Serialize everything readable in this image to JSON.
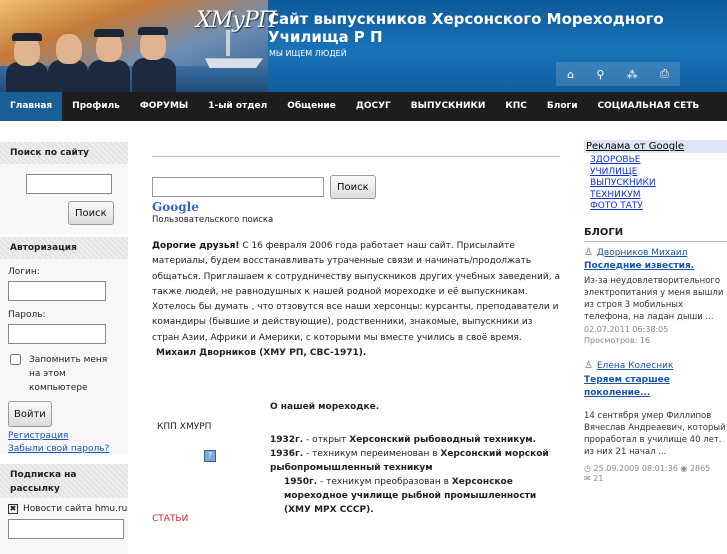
{
  "header": {
    "logo": "ХМуРП",
    "title": "Сайт выпускников Херсонского Мореходного Училища Р П",
    "slogan": "МЫ ИЩЕМ ЛЮДЕЙ",
    "tools": [
      {
        "icon": "home-icon",
        "glyph": "⌂"
      },
      {
        "icon": "search-icon",
        "glyph": "⚲"
      },
      {
        "icon": "sitemap-icon",
        "glyph": "⁂"
      },
      {
        "icon": "print-icon",
        "glyph": "⎙"
      }
    ]
  },
  "nav": {
    "items": [
      "Главная",
      "Профиль",
      "ФОРУМЫ",
      "1-ый отдел",
      "Общение",
      "ДОСУГ",
      "ВЫПУСКНИКИ",
      "КПС",
      "Блоги",
      "СОЦИАЛЬНАЯ СЕТЬ"
    ]
  },
  "sidebar": {
    "search": {
      "title": "Поиск по сайту",
      "button": "Поиск"
    },
    "auth": {
      "title": "Авторизация",
      "login_label": "Логин:",
      "password_label": "Пароль:",
      "remember_label": "Запомнить меня на этом компьютере",
      "submit": "Войти",
      "register": "Регистрация",
      "forgot": "Забыли свой пароль?"
    },
    "subscribe": {
      "title": "Подписка на рассылку",
      "option": "Новости сайта hmu.ru"
    }
  },
  "main": {
    "search_button": "Поиск",
    "google_logo": "Google",
    "google_caption": "Пользовательского поиска",
    "intro_lead": "Дорогие друзья!",
    "intro_text": " С 16 февраля 2006 года работает наш сайт. Присылайте материалы, будем восстанавливать утраченные связи и начинать/продолжать общаться. Приглашаем к сотрудничеству выпускников других учебных заведений, а также людей, не равнодушных к нашей родной мореходке и её выпускникам. Хотелось бы думать , что отзовутся все наши херсонцы: курсанты, преподаватели и командиры (бывшие и действующие), родственники, знакомые, выпускники из стран Азии, Африки и Америки, с которыми мы вместе учились в своё время.",
    "signature": "Михаил Дворников (ХМУ РП, СВС-1971).",
    "table": {
      "left_label": "КПП ХМУРП",
      "heading": "О нашей мореходке.",
      "history": [
        {
          "year": "1932г.",
          "text": " - открыт ",
          "bold": "Херсонский рыбоводный техникум."
        },
        {
          "year": "1936г.",
          "text": " - техникум переименован в ",
          "bold": "Херсонский морской рыбопромышленный техникум"
        },
        {
          "year": "1950г.",
          "text": " - техникум преобразован в ",
          "bold": "Херсонское мореходное училище рыбной промышленности (ХМУ МРХ СССР)."
        }
      ]
    },
    "more_label": "СТАТЬИ"
  },
  "right": {
    "ad_title": "Реклама от Google",
    "ad_links": [
      "ЗДОРОВЬЕ",
      "УЧИЛИЩЕ",
      "ВЫПУСКНИКИ",
      "ТЕХНИКУМ",
      "ФОТО ТАТУ"
    ],
    "blogs_title": "БЛОГИ",
    "posts": [
      {
        "author": "Дворников Михаил",
        "title": "Последние известия.",
        "text": "Из-за неудовлетворительного электропитания у меня вышли из строя 3 мобильных телефона, на ладан дыши ...",
        "date": "02.07.2011 06:38:05",
        "views": "Просмотров: 16"
      },
      {
        "author": "Елена Колесник",
        "title": "Теряем старшее поколение...",
        "text": "14 сентября умер Филлипов Вячеслав Андреаевич, который проработал в училище 40 лет. из них 21 начал ...",
        "date": "25.09.2009 08:01:36",
        "views": "2865",
        "comments": "21"
      }
    ]
  },
  "colors": {
    "header": "#1a73b8",
    "nav": "#1d1d1d",
    "nav_active": "#1a5e98",
    "link": "#1a56a8"
  }
}
